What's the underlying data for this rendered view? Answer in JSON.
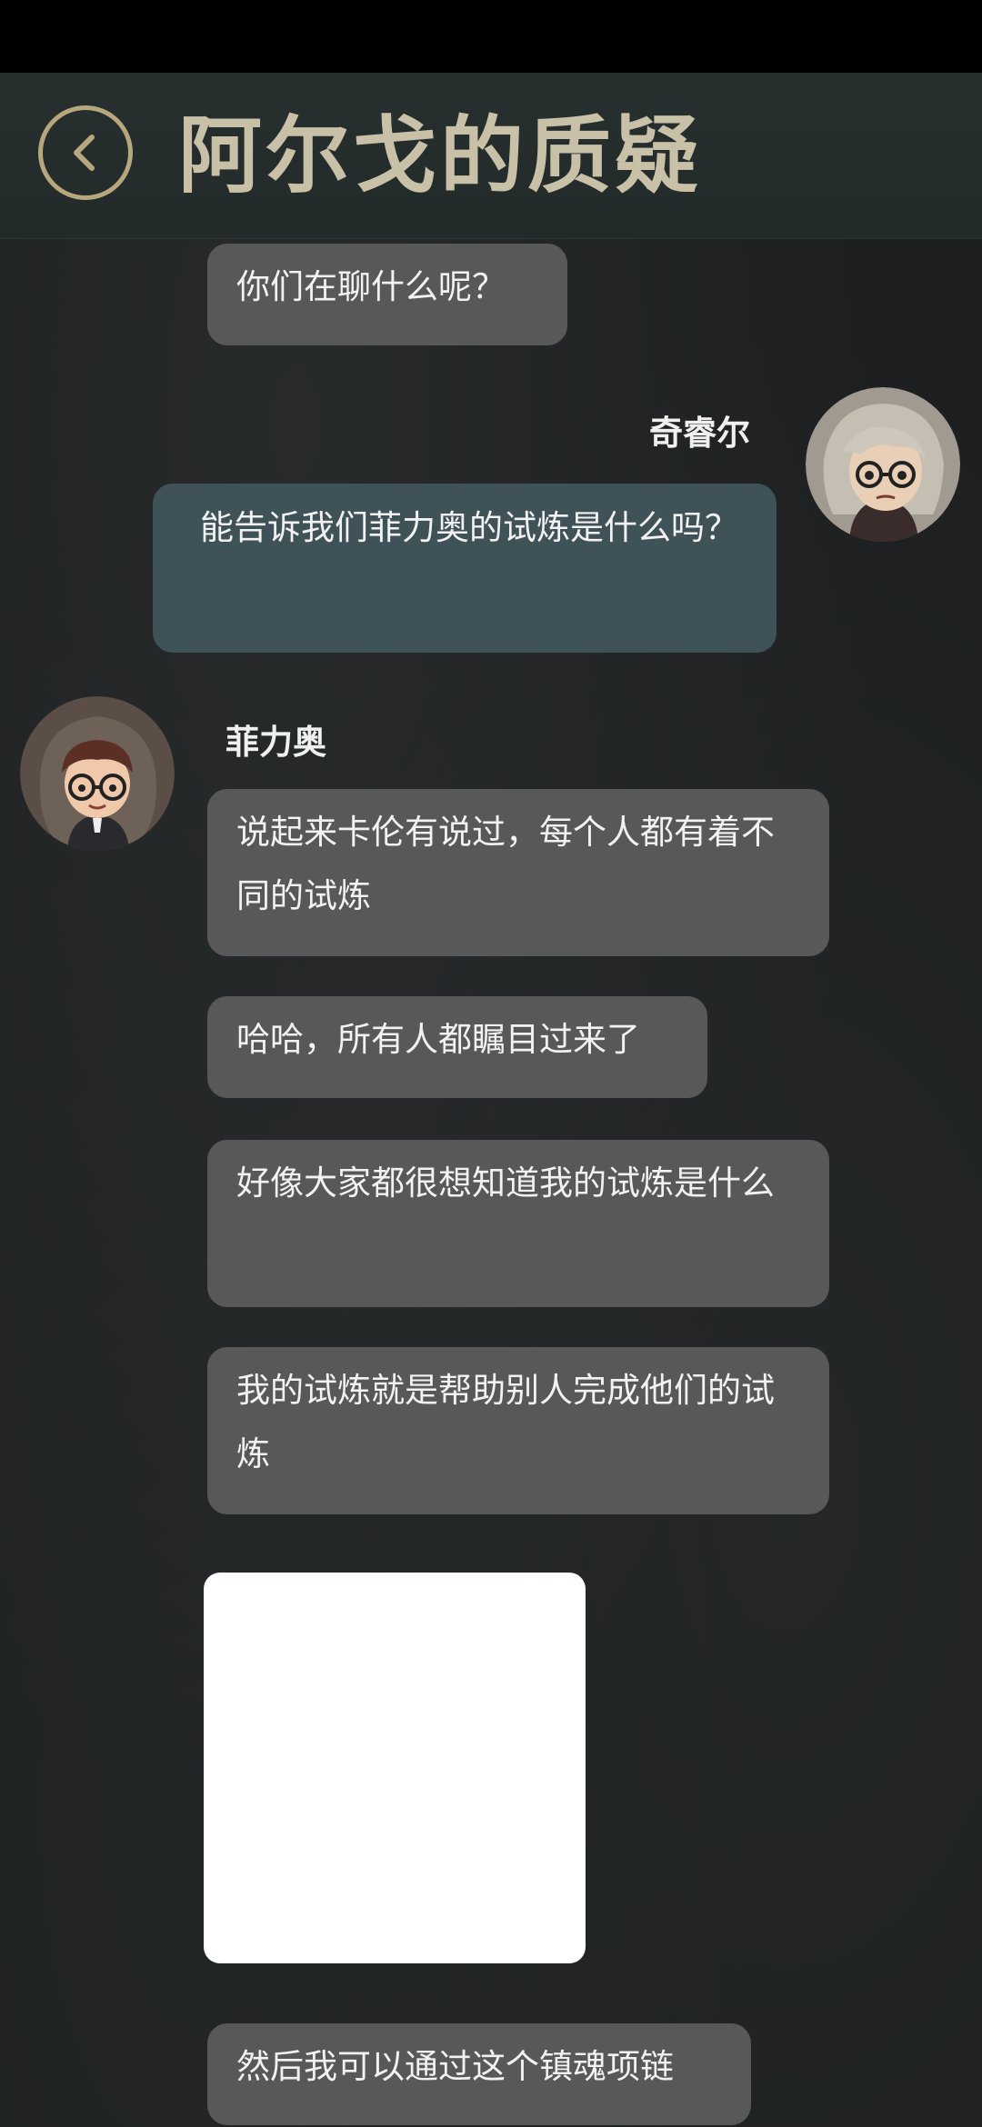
{
  "header": {
    "title": "阿尔戈的质疑",
    "back_icon": "chevron-left-icon",
    "accent_color": "#b7a77d"
  },
  "messages": [
    {
      "sender": "",
      "side": "left",
      "text": "你们在聊什么呢？"
    },
    {
      "sender": "奇睿尔",
      "side": "right",
      "text": "能告诉我们菲力奥的试炼是什么吗？"
    },
    {
      "sender": "菲力奥",
      "side": "left",
      "text": "说起来卡伦有说过，每个人都有着不同的试炼"
    },
    {
      "sender": "",
      "side": "left",
      "text": "哈哈，所有人都瞩目过来了"
    },
    {
      "sender": "",
      "side": "left",
      "text": "好像大家都很想知道我的试炼是什么"
    },
    {
      "sender": "",
      "side": "left",
      "text": "我的试炼就是帮助别人完成他们的试炼"
    },
    {
      "sender": "",
      "side": "left",
      "type": "image"
    },
    {
      "sender": "",
      "side": "left",
      "text": "然后我可以通过这个镇魂项链"
    }
  ]
}
